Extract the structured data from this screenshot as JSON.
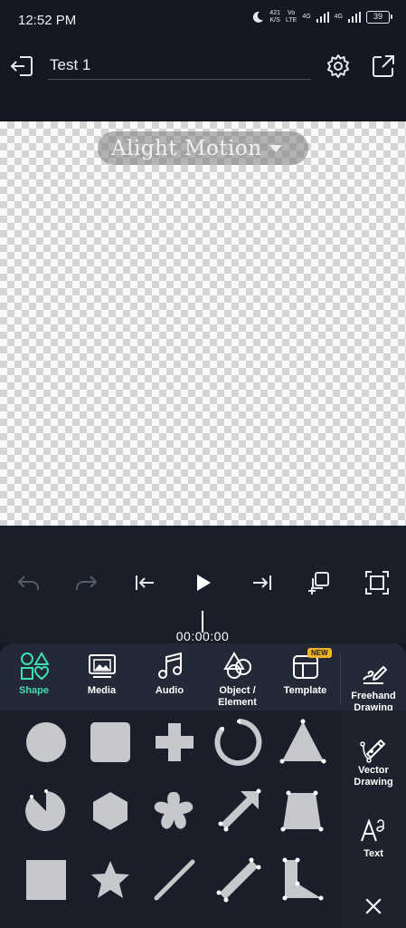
{
  "status": {
    "time": "12:52 PM",
    "speed_value": "421",
    "speed_unit": "K/S",
    "net1_top": "Vo",
    "net1_bottom": "LTE",
    "net2": "4G",
    "net3": "4G",
    "battery": "39"
  },
  "appbar": {
    "project_title": "Test 1"
  },
  "canvas": {
    "watermark": "Alight Motion"
  },
  "timeline": {
    "timecode": "00:00:00"
  },
  "tabs": [
    {
      "label": "Shape",
      "active": true
    },
    {
      "label": "Media"
    },
    {
      "label": "Audio"
    },
    {
      "label": "Object / Element"
    },
    {
      "label": "Template",
      "badge": "NEW"
    }
  ],
  "side_tools": [
    {
      "label": "Freehand Drawing"
    },
    {
      "label": "Vector Drawing"
    },
    {
      "label": "Text"
    }
  ],
  "shapes": [
    "circle",
    "rounded-square",
    "plus",
    "arc",
    "triangle",
    "pie",
    "hexagon",
    "flower",
    "arrow",
    "trapezoid",
    "square",
    "star",
    "line",
    "thick-line",
    "polygon"
  ],
  "colors": {
    "accent": "#3de0b3",
    "shape_fill": "#c6c8cc",
    "panel": "#242937"
  }
}
